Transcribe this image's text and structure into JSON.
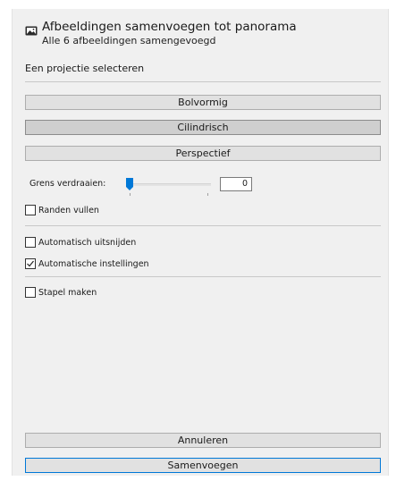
{
  "header": {
    "title": "Afbeeldingen samenvoegen tot panorama",
    "subtitle": "Alle 6 afbeeldingen samengevoegd",
    "icon": "panorama-icon"
  },
  "projection": {
    "label": "Een projectie selecteren",
    "options": [
      "Bolvormig",
      "Cilindrisch",
      "Perspectief"
    ],
    "selected": "Cilindrisch"
  },
  "warp": {
    "label": "Grens verdraaien:",
    "value": "0",
    "slider_fraction": 0
  },
  "options": {
    "fill_edges": {
      "label": "Randen vullen",
      "checked": false
    },
    "auto_crop": {
      "label": "Automatisch uitsnijden",
      "checked": false
    },
    "auto_settings": {
      "label": "Automatische instellingen",
      "checked": true
    },
    "create_stack": {
      "label": "Stapel maken",
      "checked": false
    }
  },
  "footer": {
    "cancel_label": "Annuleren",
    "merge_label": "Samenvoegen"
  },
  "colors": {
    "accent": "#0078d7",
    "panel": "#f0f0f0"
  }
}
